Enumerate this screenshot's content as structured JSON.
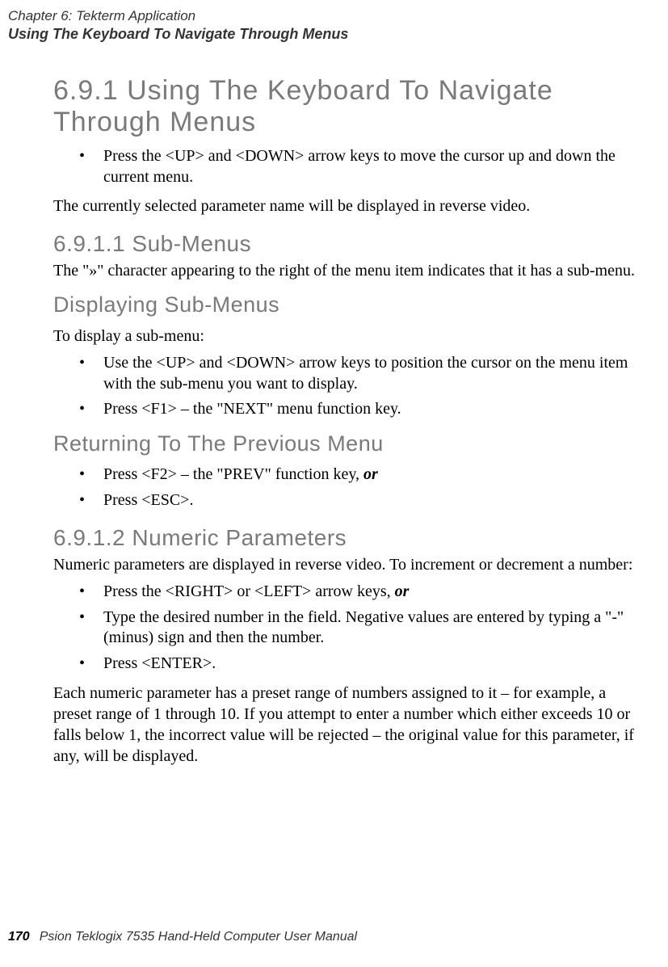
{
  "header": {
    "chapter_line": "Chapter  6:  Tekterm Application",
    "title": "Using The Keyboard To Navigate Through Menus"
  },
  "section_691": {
    "heading": "6.9.1   Using  The  Keyboard  To  Navigate  Through  Menus",
    "bullet1": "Press the <UP> and <DOWN> arrow keys to move the cursor up and down the current menu.",
    "para1": "The currently selected parameter name will be displayed in reverse video."
  },
  "section_6911": {
    "heading": "6.9.1.1    Sub-Menus",
    "para1": "The \"»\" character appearing to the right of the menu item indicates that it has a sub-menu.",
    "sub_heading": "Displaying  Sub-Menus",
    "para2": "To display a sub-menu:",
    "bullet1": "Use the <UP> and <DOWN> arrow keys to position the cursor on the menu item with the sub-menu you want to display.",
    "bullet2": "Press <F1> – the \"NEXT\" menu function key.",
    "return_heading": "Returning  To  The  Previous  Menu",
    "bullet3_pre": "Press <F2> – the \"PREV\" function key, ",
    "bullet3_or": "or",
    "bullet4": "Press <ESC>."
  },
  "section_6912": {
    "heading": "6.9.1.2    Numeric Parameters",
    "para1": "Numeric parameters are displayed in reverse video. To increment or decrement a number:",
    "bullet1_pre": "Press the <RIGHT> or <LEFT> arrow keys, ",
    "bullet1_or": "or",
    "bullet2": "Type the desired number in the field. Negative values are entered by typing a \"-\" (minus) sign and then the number.",
    "bullet3": "Press <ENTER>.",
    "para2": "Each numeric parameter has a preset range of numbers assigned to it – for example, a preset range of 1 through 10. If you attempt to enter a number which either exceeds 10 or falls below 1, the incorrect value will be rejected – the original value for this parameter, if any, will be displayed."
  },
  "footer": {
    "page_num": "170",
    "text": "Psion Teklogix 7535 Hand-Held Computer User Manual"
  }
}
